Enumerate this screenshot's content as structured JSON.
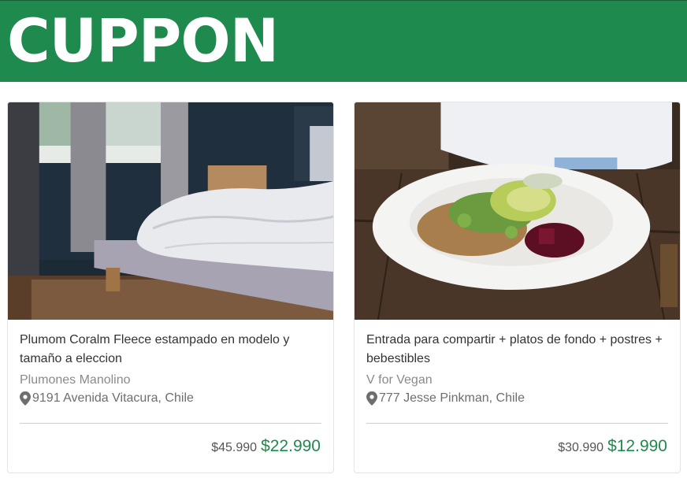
{
  "header": {
    "logo_text": "CUPPON",
    "color": "#1f8a4d"
  },
  "cards": [
    {
      "image_name": "bedroom-photo",
      "title": "Plumom Coralm Fleece estampado en modelo y tamaño a eleccion",
      "merchant": "Plumones Manolino",
      "location_icon": "map-marker-icon",
      "location": "9191 Avenida Vitacura, Chile",
      "old_price": "$45.990",
      "new_price": "$22.990"
    },
    {
      "image_name": "salad-bowl-photo",
      "title": "Entrada para compartir + platos de fondo + postres + bebestibles",
      "merchant": "V for Vegan",
      "location_icon": "map-marker-icon",
      "location": "777 Jesse Pinkman, Chile",
      "old_price": "$30.990",
      "new_price": "$12.990"
    }
  ],
  "colors": {
    "accent": "#1f8a4d",
    "muted_text": "#8a8a8a"
  }
}
